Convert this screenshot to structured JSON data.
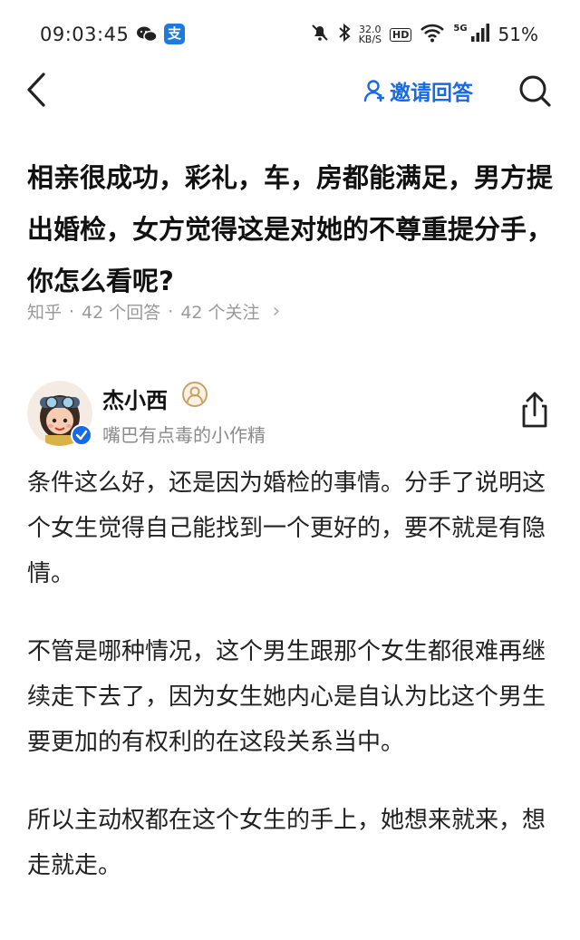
{
  "status_bar": {
    "time": "09:03:45",
    "app_badge": "支",
    "net_speed_value": "32.0",
    "net_speed_unit": "KB/S",
    "hd_label": "HD",
    "network_label": "5G",
    "battery": "51%"
  },
  "nav": {
    "invite_label": "邀请回答"
  },
  "question": {
    "title": "相亲很成功，彩礼，车，房都能满足，男方提出婚检，女方觉得这是对她的不尊重提分手，你怎么看呢?",
    "source": "知乎",
    "answer_count": "42 个回答",
    "follow_count": "42 个关注"
  },
  "author": {
    "name": "杰小西",
    "bio": "嘴巴有点毒的小作精"
  },
  "answer": {
    "paragraphs": [
      "条件这么好，还是因为婚检的事情。分手了说明这个女生觉得自己能找到一个更好的，要不就是有隐情。",
      "不管是哪种情况，这个男生跟那个女生都很难再继续走下去了，因为女生她内心是自认为比这个男生要更加的有权利的在这段关系当中。",
      "所以主动权都在这个女生的手上，她想来就来，想走就走。"
    ]
  },
  "colors": {
    "accent": "#1769e8",
    "meta_gray": "#999999",
    "title_text": "#111111",
    "body_text": "#222222"
  },
  "icons": [
    "back-arrow-icon",
    "person-icon",
    "search-icon",
    "share-icon",
    "verified-icon",
    "medal-icon",
    "wechat-icon",
    "mute-bell-icon",
    "bluetooth-icon",
    "wifi-icon",
    "signal-icon"
  ]
}
